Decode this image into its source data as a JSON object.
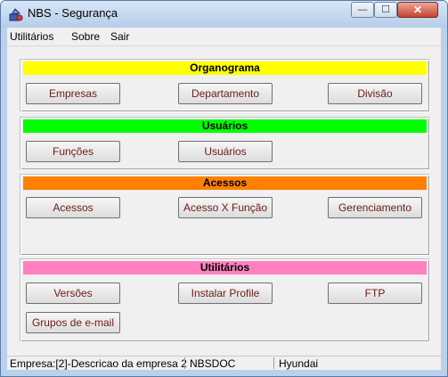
{
  "window": {
    "title": "NBS  - Segurança",
    "min_glyph": "—",
    "max_glyph": "☐",
    "close_glyph": "✕"
  },
  "menu": [
    "Utilitários",
    "Sobre",
    "Sair"
  ],
  "sections": {
    "organograma": {
      "header": "Organograma",
      "color": "#ffff00",
      "buttons": [
        "Empresas",
        "Departamento",
        "Divisão"
      ]
    },
    "usuarios": {
      "header": "Usuários",
      "color": "#00ff00",
      "buttons": [
        "Funções",
        "Usuários"
      ]
    },
    "acessos": {
      "header": "Acessos",
      "color": "#ff8000",
      "buttons": [
        "Acessos",
        "Acesso X Função",
        "Gerenciamento"
      ]
    },
    "utilitarios": {
      "header": "Utilitários",
      "color": "#ff80c0",
      "buttons": [
        "Versões",
        "Instalar Profile",
        "FTP",
        "Grupos de e-mail"
      ]
    }
  },
  "status_bar": [
    "Empresa:[2]-Descricao da empresa 2",
    "NBSDOC",
    "Hyundai"
  ]
}
